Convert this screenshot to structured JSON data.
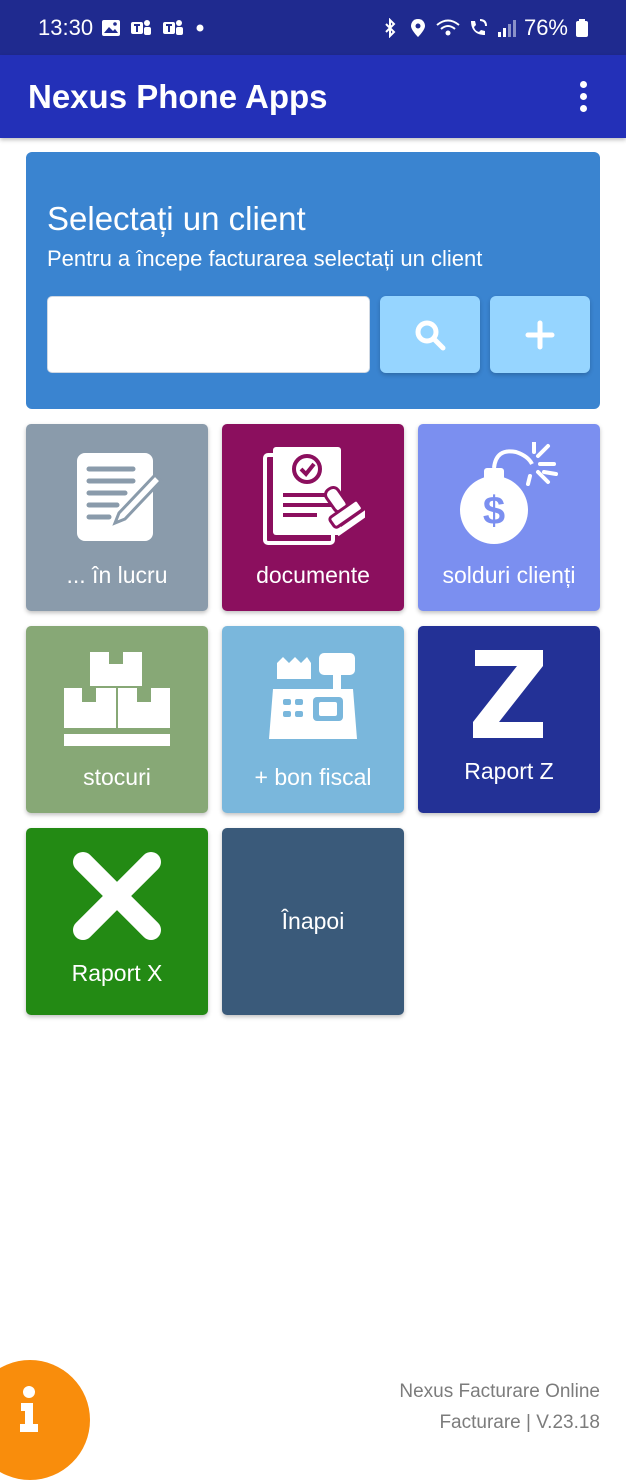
{
  "status_bar": {
    "time": "13:30",
    "battery": "76%",
    "left_icons": [
      "gallery-icon",
      "teams-icon",
      "teams-icon",
      "dot-icon"
    ],
    "right_icons": [
      "bluetooth-icon",
      "location-icon",
      "wifi-icon",
      "wifi-call-icon",
      "signal-icon",
      "battery-icon"
    ]
  },
  "app_bar": {
    "title": "Nexus Phone Apps",
    "menu_icon": "more-vert-icon"
  },
  "client_panel": {
    "title": "Selectați un client",
    "subtitle": "Pentru a începe facturarea selectați un client",
    "search_input_value": "",
    "search_button_icon": "search-icon",
    "add_button_icon": "plus-icon"
  },
  "tiles": [
    {
      "label": "... în lucru",
      "icon": "document-pencil-icon",
      "color": "#8a9bab"
    },
    {
      "label": "documente",
      "icon": "document-stamp-icon",
      "color": "#8b0f5e"
    },
    {
      "label": "solduri clienți",
      "icon": "money-bomb-icon",
      "color": "#7b8ff0"
    },
    {
      "label": "stocuri",
      "icon": "boxes-icon",
      "color": "#87a876"
    },
    {
      "label": "+ bon fiscal",
      "icon": "cash-register-icon",
      "color": "#7ab7dc"
    },
    {
      "label": "Raport Z",
      "icon": "letter-z-icon",
      "color": "#233196"
    },
    {
      "label": "Raport X",
      "icon": "x-mark-icon",
      "color": "#238a14"
    },
    {
      "label": "Înapoi",
      "icon": "",
      "color": "#3a5a7a"
    }
  ],
  "footer": {
    "line1": "Nexus Facturare Online",
    "line2": "Facturare | V.23.18"
  },
  "info_button_icon": "info-icon",
  "colors": {
    "status_bar": "#1f2a8f",
    "app_bar": "#2330b8",
    "client_panel": "#3a84d0",
    "panel_button": "#96d5ff",
    "info_fab": "#f98d0c"
  }
}
